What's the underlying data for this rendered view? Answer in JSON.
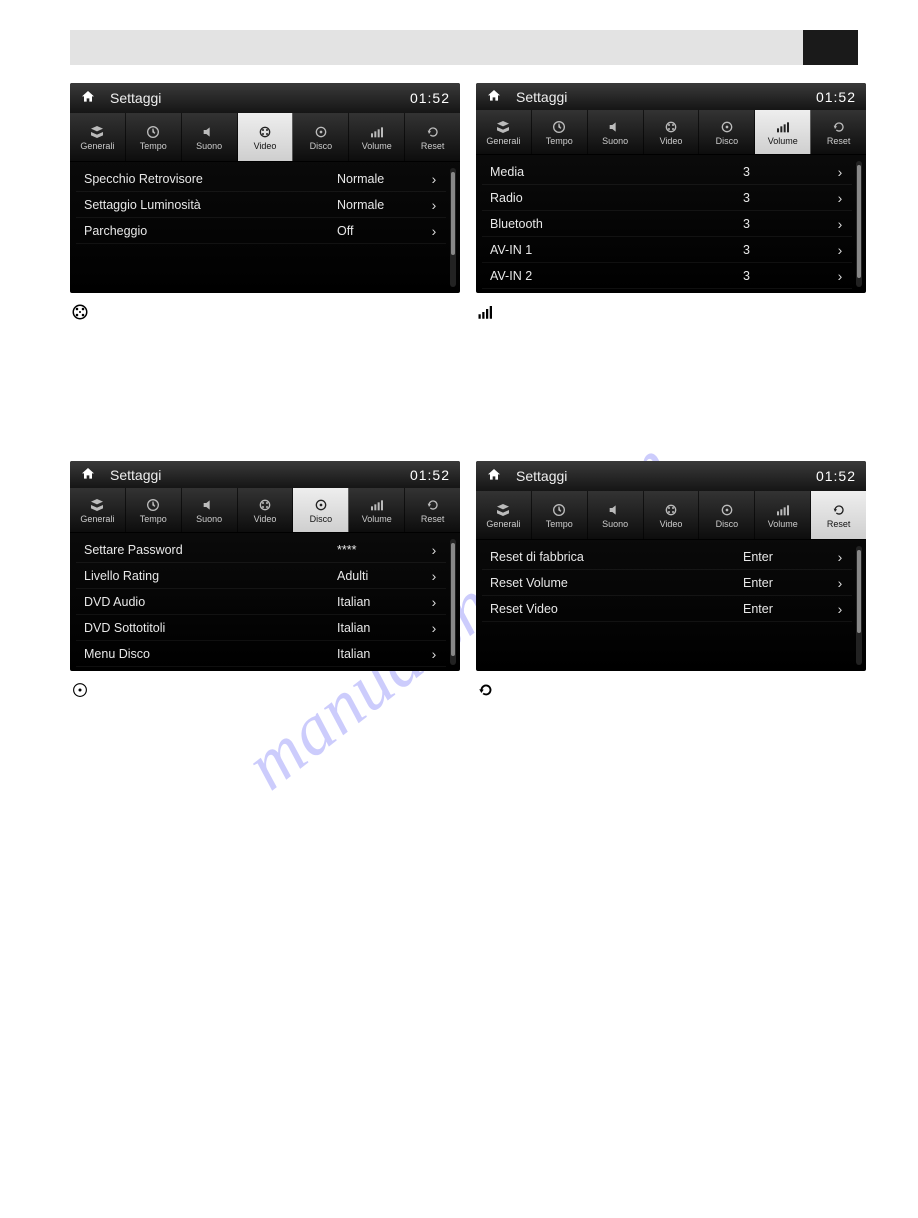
{
  "watermark": "manualshme.com",
  "topband": {},
  "clock": "01:52",
  "header_title": "Settaggi",
  "tabs": {
    "generali": "Generali",
    "tempo": "Tempo",
    "suono": "Suono",
    "video": "Video",
    "disco": "Disco",
    "volume": "Volume",
    "reset": "Reset"
  },
  "panel_video": {
    "rows": [
      {
        "label": "Specchio Retrovisore",
        "value": "Normale"
      },
      {
        "label": "Settaggio Luminosità",
        "value": "Normale"
      },
      {
        "label": "Parcheggio",
        "value": "Off"
      }
    ]
  },
  "panel_volume": {
    "rows": [
      {
        "label": "Media",
        "value": "3"
      },
      {
        "label": "Radio",
        "value": "3"
      },
      {
        "label": "Bluetooth",
        "value": "3"
      },
      {
        "label": "AV-IN 1",
        "value": "3"
      },
      {
        "label": "AV-IN 2",
        "value": "3"
      }
    ]
  },
  "panel_disco": {
    "rows": [
      {
        "label": "Settare Password",
        "value": "****"
      },
      {
        "label": "Livello Rating",
        "value": "Adulti"
      },
      {
        "label": "DVD Audio",
        "value": "Italian"
      },
      {
        "label": "DVD Sottotitoli",
        "value": "Italian"
      },
      {
        "label": "Menu Disco",
        "value": "Italian"
      }
    ]
  },
  "panel_reset": {
    "rows": [
      {
        "label": "Reset di fabbrica",
        "value": "Enter"
      },
      {
        "label": "Reset Volume",
        "value": "Enter"
      },
      {
        "label": "Reset Video",
        "value": "Enter"
      }
    ]
  }
}
